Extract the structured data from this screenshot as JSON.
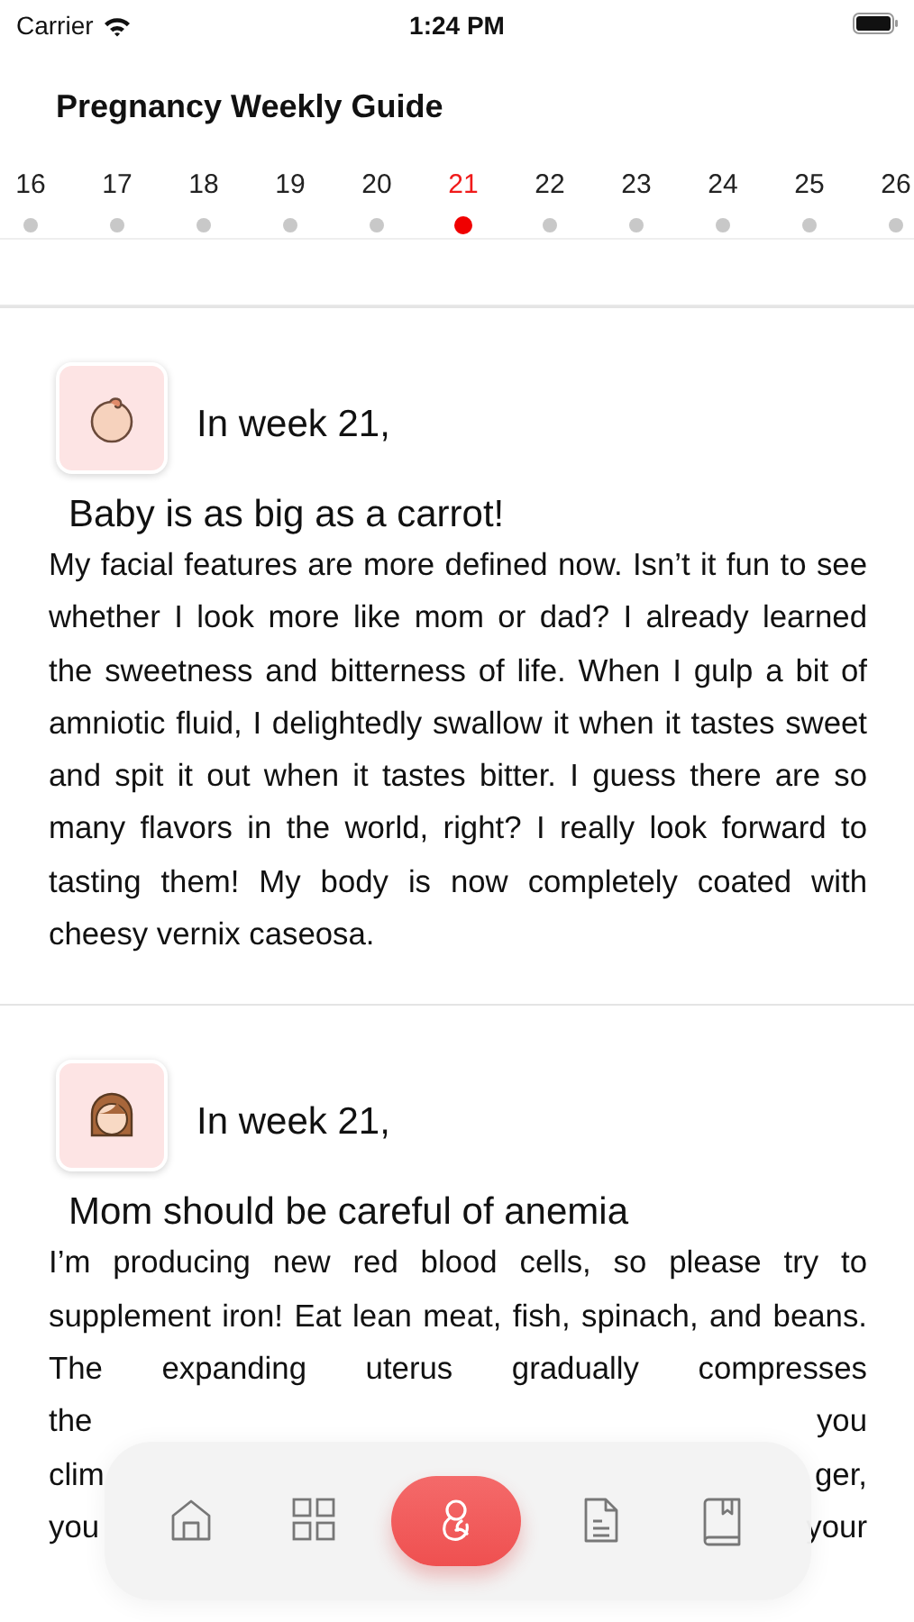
{
  "status_bar": {
    "carrier": "Carrier",
    "time": "1:24 PM"
  },
  "header": {
    "title": "Pregnancy Weekly Guide"
  },
  "weeks": [
    {
      "label": "16",
      "selected": false
    },
    {
      "label": "17",
      "selected": false
    },
    {
      "label": "18",
      "selected": false
    },
    {
      "label": "19",
      "selected": false
    },
    {
      "label": "20",
      "selected": false
    },
    {
      "label": "21",
      "selected": true
    },
    {
      "label": "22",
      "selected": false
    },
    {
      "label": "23",
      "selected": false
    },
    {
      "label": "24",
      "selected": false
    },
    {
      "label": "25",
      "selected": false
    },
    {
      "label": "26",
      "selected": false
    }
  ],
  "cards": [
    {
      "kind": "baby",
      "intro": "In week 21,",
      "heading": "Baby is as big as a carrot!",
      "text": "My facial features are more defined now. Isn’t it fun to see whether I look more like mom or dad? I already learned the sweetness and bitterness of life. When I gulp a bit of amniotic fluid, I delightedly swallow it when it tastes sweet and spit it out when it tastes bitter. I guess there are so many flavors in the world, right? I really look forward to tasting them! My body is now completely coated with cheesy vernix caseosa."
    },
    {
      "kind": "mom",
      "intro": "In week 21,",
      "heading": "Mom should be careful of anemia",
      "text": "I’m producing new red blood cells, so please try to supplement iron! Eat lean meat, fish, spinach, and beans. The expanding uterus gradually compresses",
      "covered_lines": [
        {
          "left": "the",
          "right": "you"
        },
        {
          "left": "clim",
          "right": "ger,"
        },
        {
          "left": "you",
          "right": "your"
        }
      ]
    }
  ],
  "tab_bar": {
    "items": [
      {
        "kind": "home",
        "selected": false
      },
      {
        "kind": "grid",
        "selected": false
      },
      {
        "kind": "fetus",
        "selected": true
      },
      {
        "kind": "document",
        "selected": false
      },
      {
        "kind": "book",
        "selected": false
      }
    ]
  }
}
